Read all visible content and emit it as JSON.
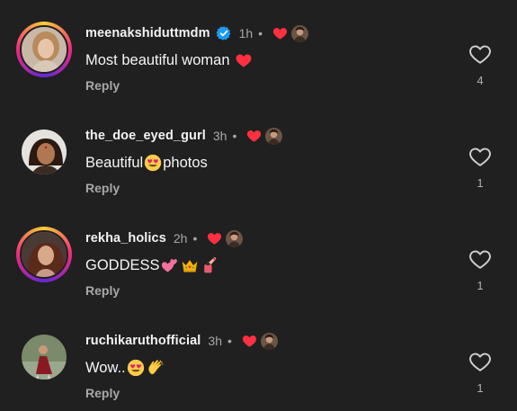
{
  "comments": [
    {
      "username": "meenakshiduttmdm",
      "verified": true,
      "time": "1h",
      "separator": "•",
      "text_parts": [
        "Most beautiful woman"
      ],
      "emoji": [
        "red-heart"
      ],
      "reply_label": "Reply",
      "likes": "4",
      "story_ring": true
    },
    {
      "username": "the_doe_eyed_gurl",
      "verified": false,
      "time": "3h",
      "separator": "•",
      "text_parts": [
        "Beautiful ",
        "photos"
      ],
      "emoji": [
        "heart-eyes"
      ],
      "reply_label": "Reply",
      "likes": "1",
      "story_ring": false
    },
    {
      "username": "rekha_holics",
      "verified": false,
      "time": "2h",
      "separator": "•",
      "text_parts": [
        "GODDESS"
      ],
      "emoji": [
        "two-hearts",
        "crown",
        "nail-polish"
      ],
      "reply_label": "Reply",
      "likes": "1",
      "story_ring": true
    },
    {
      "username": "ruchikaruthofficial",
      "verified": false,
      "time": "3h",
      "separator": "•",
      "text_parts": [
        "Wow.."
      ],
      "emoji": [
        "heart-eyes",
        "clapping-hands"
      ],
      "reply_label": "Reply",
      "likes": "1",
      "story_ring": false
    }
  ],
  "colors": {
    "background": "#202020",
    "text": "#f5f5f5",
    "muted": "#a8a8a8",
    "liked_red": "#ff3040",
    "verified_blue": "#1d9bf0"
  }
}
